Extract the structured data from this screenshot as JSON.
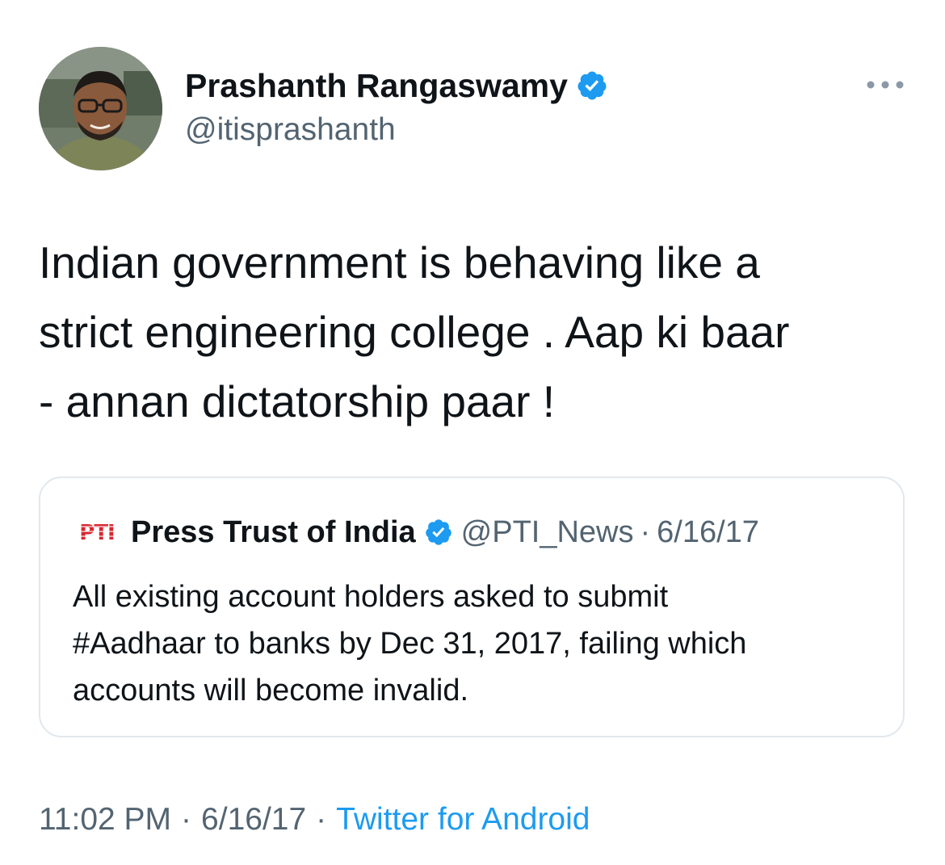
{
  "author": {
    "display_name": "Prashanth Rangaswamy",
    "handle": "@itisprashanth",
    "avatar_icon": "profile-photo",
    "verified": true
  },
  "more_icon": "ellipsis-icon",
  "tweet": {
    "lines": [
      "Indian government is behaving like a",
      "strict engineering college . Aap ki baar",
      "- annan dictatorship paar !"
    ]
  },
  "quote": {
    "logo_text": "PTI",
    "name": "Press Trust of India",
    "handle": "@PTI_News",
    "separator": "·",
    "date": "6/16/17",
    "lines": [
      "All existing account holders asked to submit",
      "#Aadhaar to banks by Dec 31, 2017, failing which",
      "accounts will become invalid."
    ]
  },
  "footer": {
    "time": "11:02 PM",
    "separator": "·",
    "date": "6/16/17",
    "source": "Twitter for Android"
  },
  "colors": {
    "verified": "#1d9bf0",
    "link": "#1d9bf0",
    "secondary_text": "#536471",
    "border": "#e1e8ed",
    "pti_red": "#d8262f"
  }
}
